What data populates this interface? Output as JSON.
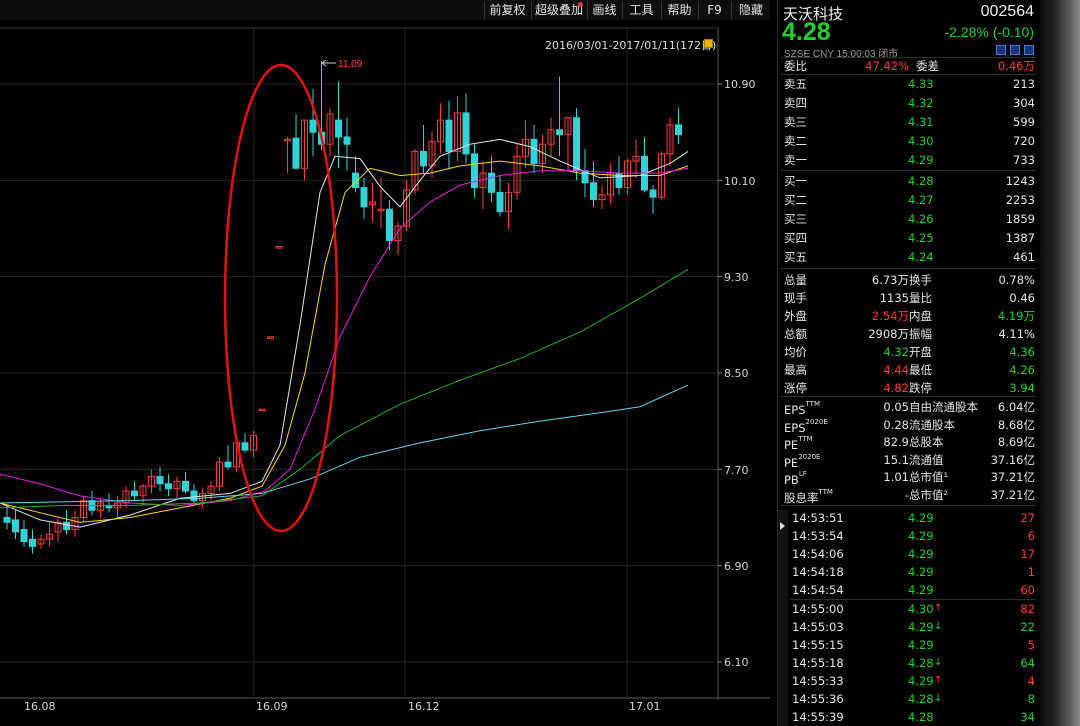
{
  "toolbar": {
    "buttons": [
      "前复权",
      "超级叠加",
      "画线",
      "工具",
      "帮助",
      "F9",
      "隐藏"
    ]
  },
  "chart": {
    "range_label": "2016/03/01-2017/01/11(172日)",
    "peak_label": "11.09",
    "y_ticks": [
      "10.90",
      "10.10",
      "9.30",
      "8.50",
      "7.70",
      "6.90",
      "6.10"
    ],
    "x_ticks": [
      "16.08",
      "16.09",
      "16.12",
      "17.01"
    ],
    "colors": {
      "up": "#ff3b3b",
      "down": "#2fd3d8",
      "ma_white": "#e6e6e6",
      "ma_yellow": "#ffd700",
      "ma_magenta": "#e020e0",
      "ma_green": "#1fb01f",
      "ma_cyan": "#5fd8ee",
      "ellipse": "#e81010"
    }
  },
  "chart_data": {
    "type": "candlestick",
    "ylim": [
      5.9,
      11.2
    ],
    "x_tick_labels": [
      "16.08",
      "16.09",
      "16.12",
      "17.01"
    ],
    "y_tick_labels": [
      "10.90",
      "10.10",
      "9.30",
      "8.50",
      "7.70",
      "6.90",
      "6.10"
    ],
    "annotations": [
      "11.09"
    ],
    "grid": true
  },
  "quote": {
    "name": "天沃科技",
    "code": "002564",
    "price": "4.28",
    "change": "-2.28% (-0.10)",
    "meta": "SZSE  CNY  15:00:03  闭市",
    "weibi_label": "委比",
    "weibi_value": "47.42%",
    "weicha_label": "委差",
    "weicha_value": "0.46万",
    "asks": [
      {
        "label": "卖五",
        "price": "4.33",
        "vol": "213"
      },
      {
        "label": "卖四",
        "price": "4.32",
        "vol": "304"
      },
      {
        "label": "卖三",
        "price": "4.31",
        "vol": "599"
      },
      {
        "label": "卖二",
        "price": "4.30",
        "vol": "720"
      },
      {
        "label": "卖一",
        "price": "4.29",
        "vol": "733"
      }
    ],
    "bids": [
      {
        "label": "买一",
        "price": "4.28",
        "vol": "1243"
      },
      {
        "label": "买二",
        "price": "4.27",
        "vol": "2253"
      },
      {
        "label": "买三",
        "price": "4.26",
        "vol": "1859"
      },
      {
        "label": "买四",
        "price": "4.25",
        "vol": "1387"
      },
      {
        "label": "买五",
        "price": "4.24",
        "vol": "461"
      }
    ],
    "stats": [
      {
        "l1": "总量",
        "v1": "6.73万",
        "c1": "white",
        "l2": "换手",
        "v2": "0.78%",
        "c2": "white"
      },
      {
        "l1": "现手",
        "v1": "1135",
        "c1": "white",
        "l2": "量比",
        "v2": "0.46",
        "c2": "white"
      },
      {
        "l1": "外盘",
        "v1": "2.54万",
        "c1": "red",
        "l2": "内盘",
        "v2": "4.19万",
        "c2": "green"
      },
      {
        "l1": "总额",
        "v1": "2908万",
        "c1": "white",
        "l2": "振幅",
        "v2": "4.11%",
        "c2": "white"
      },
      {
        "l1": "均价",
        "v1": "4.32",
        "c1": "green",
        "l2": "开盘",
        "v2": "4.36",
        "c2": "green"
      },
      {
        "l1": "最高",
        "v1": "4.44",
        "c1": "red",
        "l2": "最低",
        "v2": "4.26",
        "c2": "green"
      },
      {
        "l1": "涨停",
        "v1": "4.82",
        "c1": "red",
        "l2": "跌停",
        "v2": "3.94",
        "c2": "green"
      }
    ],
    "fundamentals": [
      {
        "l1": "EPS",
        "s1": "TTM",
        "v1": "0.05",
        "l2": "自由流通股本",
        "v2": "6.04亿"
      },
      {
        "l1": "EPS",
        "s1": "2020E",
        "v1": "0.28",
        "l2": "流通股本",
        "v2": "8.68亿"
      },
      {
        "l1": "PE",
        "s1": "TTM",
        "v1": "82.9",
        "l2": "总股本",
        "v2": "8.69亿"
      },
      {
        "l1": "PE",
        "s1": "2020E",
        "v1": "15.1",
        "l2": "流通值",
        "v2": "37.16亿"
      },
      {
        "l1": "PB",
        "s1": "LF",
        "v1": "1.01",
        "l2": "总市值¹",
        "v2": "37.21亿"
      },
      {
        "l1": "股息率",
        "s1": "TTM",
        "v1": "-",
        "l2": "总市值²",
        "v2": "37.21亿"
      }
    ],
    "ticks_group1": [
      {
        "time": "14:53:51",
        "price": "4.29",
        "pc": "green",
        "arrow": "",
        "vol": "27",
        "vc": "red"
      },
      {
        "time": "14:53:54",
        "price": "4.29",
        "pc": "green",
        "arrow": "",
        "vol": "6",
        "vc": "red"
      },
      {
        "time": "14:54:06",
        "price": "4.29",
        "pc": "green",
        "arrow": "",
        "vol": "17",
        "vc": "red"
      },
      {
        "time": "14:54:18",
        "price": "4.29",
        "pc": "green",
        "arrow": "",
        "vol": "1",
        "vc": "red"
      },
      {
        "time": "14:54:54",
        "price": "4.29",
        "pc": "green",
        "arrow": "",
        "vol": "60",
        "vc": "red"
      }
    ],
    "ticks_group2": [
      {
        "time": "14:55:00",
        "price": "4.30",
        "pc": "green",
        "arrow": "↑",
        "ac": "red",
        "vol": "82",
        "vc": "red"
      },
      {
        "time": "14:55:03",
        "price": "4.29",
        "pc": "green",
        "arrow": "↓",
        "ac": "green",
        "vol": "22",
        "vc": "green"
      },
      {
        "time": "14:55:15",
        "price": "4.29",
        "pc": "green",
        "arrow": "",
        "vol": "5",
        "vc": "red"
      },
      {
        "time": "14:55:18",
        "price": "4.28",
        "pc": "green",
        "arrow": "↓",
        "ac": "green",
        "vol": "64",
        "vc": "green"
      },
      {
        "time": "14:55:33",
        "price": "4.29",
        "pc": "green",
        "arrow": "↑",
        "ac": "red",
        "vol": "4",
        "vc": "red"
      },
      {
        "time": "14:55:36",
        "price": "4.28",
        "pc": "green",
        "arrow": "↓",
        "ac": "green",
        "vol": "8",
        "vc": "green"
      },
      {
        "time": "14:55:39",
        "price": "4.28",
        "pc": "green",
        "arrow": "",
        "vol": "34",
        "vc": "green"
      }
    ]
  }
}
